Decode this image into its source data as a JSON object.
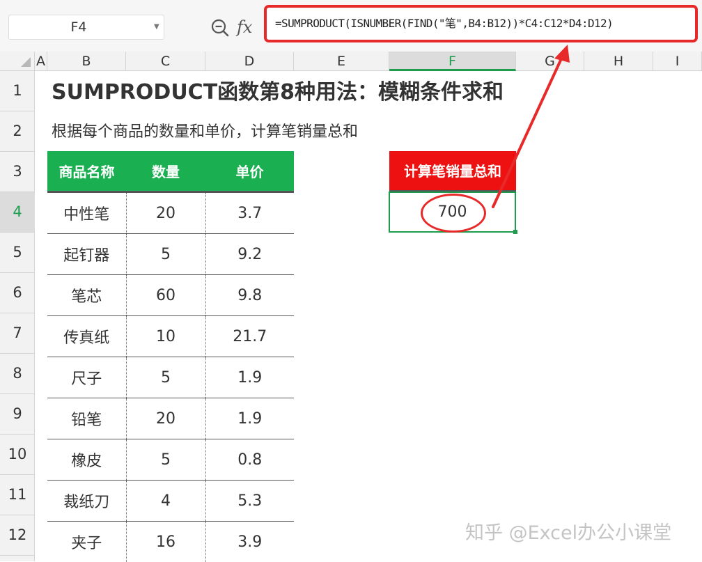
{
  "formula_bar": {
    "name_box": "F4",
    "zoom_icon": "zoom-in-icon",
    "fx_label": "fx",
    "formula": "=SUMPRODUCT(ISNUMBER(FIND(\"笔\",B4:B12))*C4:C12*D4:D12)"
  },
  "grid": {
    "columns": [
      "A",
      "B",
      "C",
      "D",
      "E",
      "F",
      "G",
      "H",
      "I"
    ],
    "rows": [
      "1",
      "2",
      "3",
      "4",
      "5",
      "6",
      "7",
      "8",
      "9",
      "10",
      "11",
      "12"
    ],
    "active_column": "F",
    "active_row": "4"
  },
  "sheet": {
    "title": "SUMPRODUCT函数第8种用法：模糊条件求和",
    "subtitle": "根据每个商品的数量和单价，计算笔销量总和",
    "table": {
      "headers": [
        "商品名称",
        "数量",
        "单价"
      ],
      "rows": [
        [
          "中性笔",
          "20",
          "3.7"
        ],
        [
          "起钉器",
          "5",
          "9.2"
        ],
        [
          "笔芯",
          "60",
          "9.8"
        ],
        [
          "传真纸",
          "10",
          "21.7"
        ],
        [
          "尺子",
          "5",
          "1.9"
        ],
        [
          "铅笔",
          "20",
          "1.9"
        ],
        [
          "橡皮",
          "5",
          "0.8"
        ],
        [
          "裁纸刀",
          "4",
          "5.3"
        ],
        [
          "夹子",
          "16",
          "3.9"
        ]
      ]
    },
    "result": {
      "header": "计算笔销量总和",
      "value": "700"
    },
    "colors": {
      "table_header": "#1aaf51",
      "result_header": "#ee1111",
      "annotation": "#e8292a",
      "selection": "#1e9c4d"
    }
  },
  "watermark": "知乎 @Excel办公小课堂"
}
